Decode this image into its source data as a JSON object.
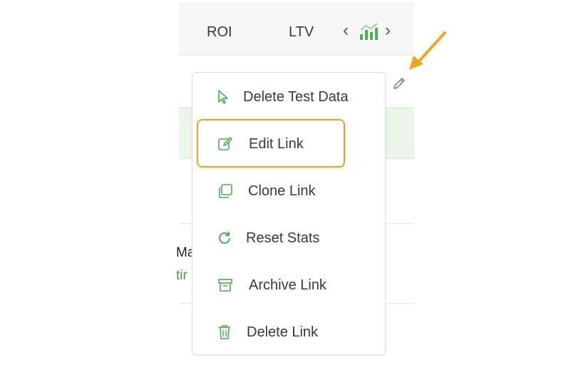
{
  "table": {
    "columns": [
      "ROI",
      "LTV"
    ],
    "nav_prev": "‹",
    "nav_next": "›",
    "row_partial_text": [
      "Ma",
      "tir"
    ]
  },
  "menu": {
    "items": [
      {
        "label": "Delete Test Data",
        "icon": "cursor-icon"
      },
      {
        "label": "Edit Link",
        "icon": "edit-icon",
        "highlighted": true
      },
      {
        "label": "Clone Link",
        "icon": "clone-icon"
      },
      {
        "label": "Reset Stats",
        "icon": "refresh-icon"
      },
      {
        "label": "Archive Link",
        "icon": "archive-icon"
      },
      {
        "label": "Delete Link",
        "icon": "trash-icon"
      }
    ]
  },
  "colors": {
    "accent_green": "#4caf50",
    "highlight": "#e7a52b",
    "row_green": "#e9f6e8"
  }
}
